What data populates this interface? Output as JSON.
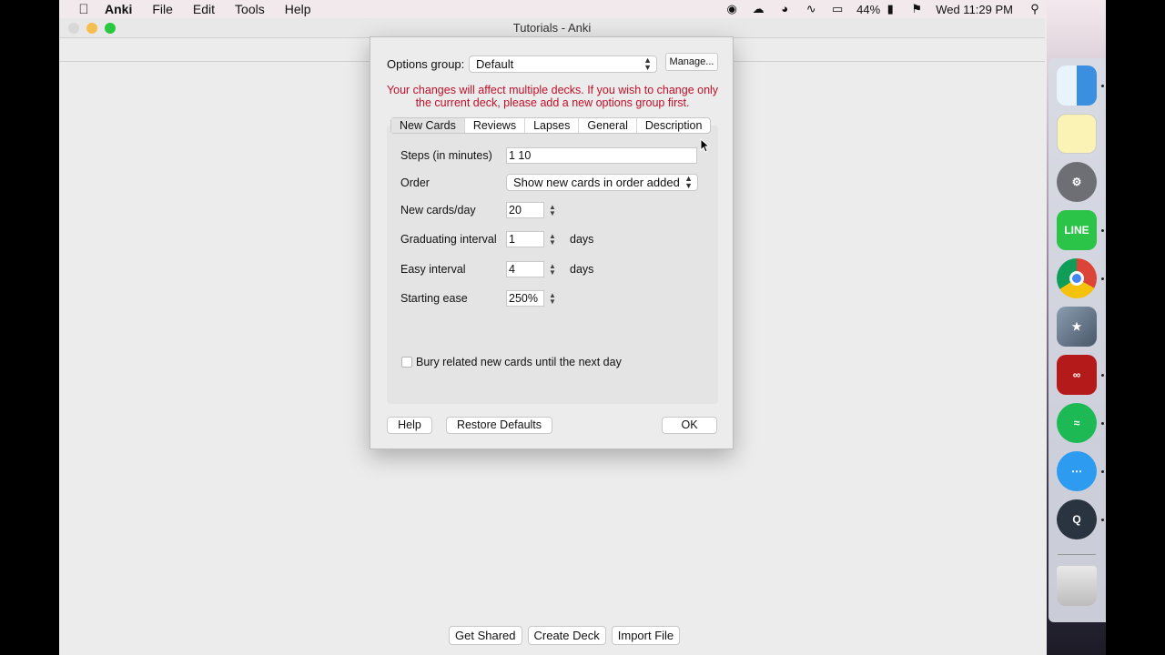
{
  "menubar": {
    "app_name": "Anki",
    "items": [
      "File",
      "Edit",
      "Tools",
      "Help"
    ],
    "battery": "44%",
    "clock": "Wed 11:29 PM",
    "status_icons": [
      "record-icon",
      "cloud-icon",
      "mask-icon",
      "wifi-icon",
      "airplay-icon",
      "battery-icon",
      "flag-icon",
      "search-icon",
      "siri-icon",
      "list-icon"
    ]
  },
  "window": {
    "title": "Tutorials - Anki",
    "bottom_buttons": [
      "Get Shared",
      "Create Deck",
      "Import File"
    ]
  },
  "dialog": {
    "options_group_label": "Options group:",
    "options_group_value": "Default",
    "manage_label": "Manage...",
    "warning": "Your changes will affect multiple decks. If you wish to change only the current deck, please add a new options group first.",
    "tabs": [
      "New Cards",
      "Reviews",
      "Lapses",
      "General",
      "Description"
    ],
    "active_tab": "New Cards",
    "fields": {
      "steps_label": "Steps (in minutes)",
      "steps_value": "1 10",
      "order_label": "Order",
      "order_value": "Show new cards in order added",
      "new_per_day_label": "New cards/day",
      "new_per_day_value": "20",
      "graduating_label": "Graduating interval",
      "graduating_value": "1",
      "graduating_unit": "days",
      "easy_label": "Easy interval",
      "easy_value": "4",
      "easy_unit": "days",
      "ease_label": "Starting ease",
      "ease_value": "250%",
      "bury_label": "Bury related new cards until the next day"
    },
    "buttons": {
      "help": "Help",
      "restore": "Restore Defaults",
      "ok": "OK"
    }
  },
  "dock": {
    "apps": [
      "finder-icon",
      "notes-icon",
      "system-preferences-icon",
      "line-icon",
      "chrome-icon",
      "xcode-icon",
      "acrobat-icon",
      "spotify-icon",
      "messages-icon",
      "quicktime-icon",
      "trash-icon"
    ],
    "line_label": "LINE",
    "colors": {
      "finder": "#3b8fe0",
      "line": "#2bc348",
      "acrobat": "#b51a1a",
      "spotify": "#1db954",
      "messages": "#2d9bf0"
    }
  }
}
